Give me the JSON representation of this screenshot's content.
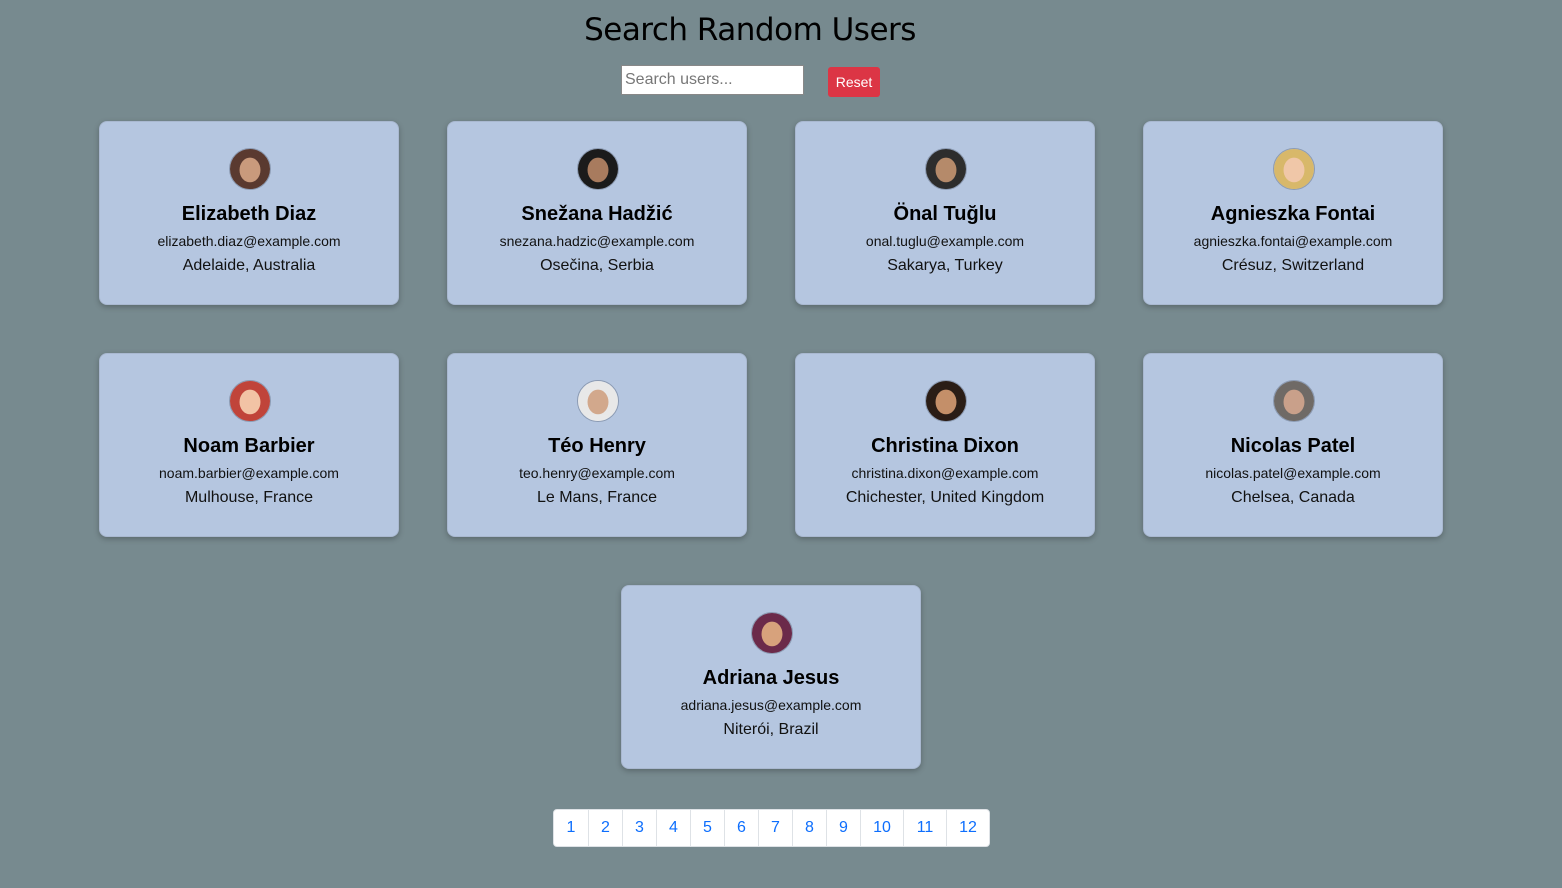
{
  "header": {
    "title": "Search Random Users"
  },
  "search": {
    "placeholder": "Search users...",
    "value": "",
    "reset_label": "Reset",
    "reset_color": "#dc3545"
  },
  "users": [
    {
      "name": "Elizabeth Diaz",
      "email": "elizabeth.diaz@example.com",
      "location": "Adelaide, Australia",
      "avatar_colors": [
        "#5a3a30",
        "#c99a7c"
      ]
    },
    {
      "name": "Snežana Hadžić",
      "email": "snezana.hadzic@example.com",
      "location": "Osečina, Serbia",
      "avatar_colors": [
        "#1b1b1b",
        "#a87b5e"
      ]
    },
    {
      "name": "Önal Tuğlu",
      "email": "onal.tuglu@example.com",
      "location": "Sakarya, Turkey",
      "avatar_colors": [
        "#2d2d2d",
        "#b58a6a"
      ]
    },
    {
      "name": "Agnieszka Fontai",
      "email": "agnieszka.fontai@example.com",
      "location": "Crésuz, Switzerland",
      "avatar_colors": [
        "#d8b86a",
        "#f0c7a8"
      ]
    },
    {
      "name": "Noam Barbier",
      "email": "noam.barbier@example.com",
      "location": "Mulhouse, France",
      "avatar_colors": [
        "#c0443a",
        "#f2c3a5"
      ]
    },
    {
      "name": "Téo Henry",
      "email": "teo.henry@example.com",
      "location": "Le Mans, France",
      "avatar_colors": [
        "#e8e8e8",
        "#d2a88c"
      ]
    },
    {
      "name": "Christina Dixon",
      "email": "christina.dixon@example.com",
      "location": "Chichester, United Kingdom",
      "avatar_colors": [
        "#2a1d16",
        "#c48f69"
      ]
    },
    {
      "name": "Nicolas Patel",
      "email": "nicolas.patel@example.com",
      "location": "Chelsea, Canada",
      "avatar_colors": [
        "#6f6a66",
        "#c9a08a"
      ]
    },
    {
      "name": "Adriana Jesus",
      "email": "adriana.jesus@example.com",
      "location": "Niterói, Brazil",
      "avatar_colors": [
        "#6b2a4a",
        "#d7a27c"
      ]
    }
  ],
  "pagination": {
    "pages": [
      "1",
      "2",
      "3",
      "4",
      "5",
      "6",
      "7",
      "8",
      "9",
      "10",
      "11",
      "12"
    ],
    "link_color": "#0d6efd"
  },
  "colors": {
    "background": "#778a8f",
    "card": "#b5c6e0"
  }
}
